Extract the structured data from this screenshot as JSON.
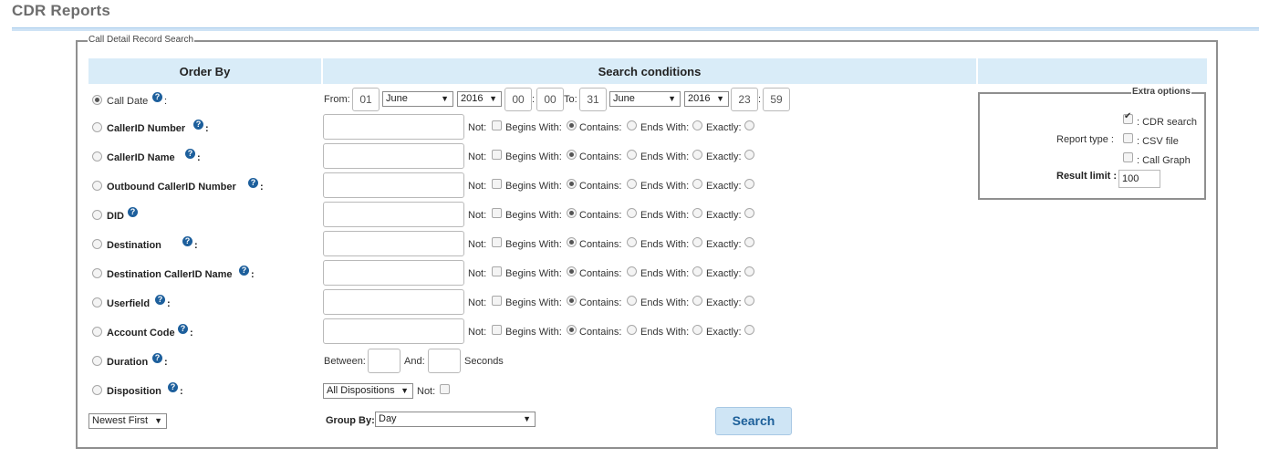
{
  "page": {
    "title": "CDR Reports"
  },
  "form": {
    "legend": "Call Detail Record Search",
    "col_order_by": "Order By",
    "col_search_conditions": "Search conditions"
  },
  "order_by": [
    {
      "label": "Call Date",
      "selected": true
    },
    {
      "label": "CallerID Number",
      "selected": false
    },
    {
      "label": "CallerID Name",
      "selected": false
    },
    {
      "label": "Outbound CallerID Number",
      "selected": false
    },
    {
      "label": "DID",
      "selected": false
    },
    {
      "label": "Destination",
      "selected": false
    },
    {
      "label": "Destination CallerID Name",
      "selected": false
    },
    {
      "label": "Userfield",
      "selected": false
    },
    {
      "label": "Account Code",
      "selected": false
    },
    {
      "label": "Duration",
      "selected": false
    },
    {
      "label": "Disposition",
      "selected": false
    }
  ],
  "date_range": {
    "from_label": "From:",
    "from_day": "01",
    "from_month": "June",
    "from_year": "2016",
    "from_hour": "00",
    "from_min": "00",
    "to_label": "To:",
    "to_day": "31",
    "to_month": "June",
    "to_year": "2016",
    "to_hour": "23",
    "to_min": "59",
    "sep": ":"
  },
  "match_labels": {
    "not": "Not:",
    "begins": "Begins With:",
    "contains": "Contains:",
    "ends": "Ends With:",
    "exactly": "Exactly:"
  },
  "duration": {
    "between": "Between:",
    "and": "And:",
    "seconds": "Seconds"
  },
  "disposition": {
    "value": "All Dispositions",
    "not": "Not:"
  },
  "order_direction": {
    "value": "Newest First"
  },
  "group_by": {
    "label": "Group By:",
    "value": "Day"
  },
  "search_button": "Search",
  "extra_options": {
    "legend": "Extra options",
    "report_type_label": "Report type :",
    "cdr_search": ": CDR search",
    "cdr_search_checked": true,
    "csv_file": ": CSV file",
    "call_graph": ": Call Graph",
    "result_limit_label": "Result limit :",
    "result_limit_value": "100"
  },
  "icons": {
    "help": "help-icon",
    "dropdown": "dropdown-arrow-icon"
  }
}
